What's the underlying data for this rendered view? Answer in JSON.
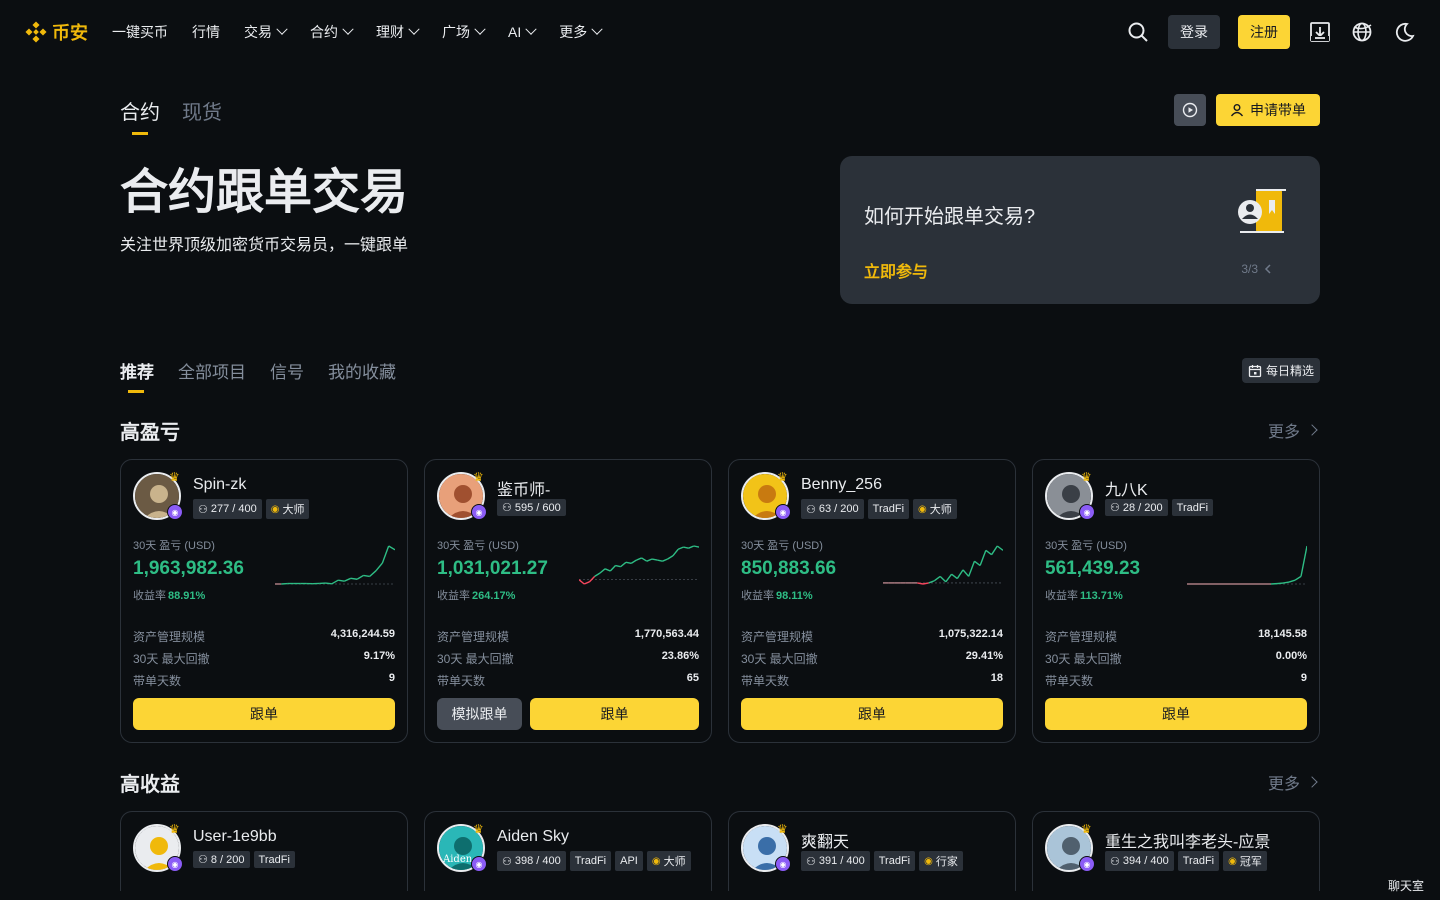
{
  "nav": {
    "logo_text": "币安",
    "items": [
      {
        "label": "一键买币",
        "dropdown": false
      },
      {
        "label": "行情",
        "dropdown": false
      },
      {
        "label": "交易",
        "dropdown": true
      },
      {
        "label": "合约",
        "dropdown": true
      },
      {
        "label": "理财",
        "dropdown": true
      },
      {
        "label": "广场",
        "dropdown": true
      },
      {
        "label": "AI",
        "dropdown": true
      },
      {
        "label": "更多",
        "dropdown": true
      }
    ],
    "login": "登录",
    "register": "注册"
  },
  "type_tabs": [
    "合约",
    "现货"
  ],
  "apply_button": "申请带单",
  "hero": {
    "title": "合约跟单交易",
    "subtitle": "关注世界顶级加密货币交易员，一键跟单"
  },
  "howto": {
    "title": "如何开始跟单交易?",
    "link": "立即参与",
    "page": "3/3"
  },
  "section_tabs": [
    "推荐",
    "全部项目",
    "信号",
    "我的收藏"
  ],
  "daily_pick": "每日精选",
  "sections": {
    "high_pnl": {
      "title": "高盈亏",
      "more": "更多"
    },
    "high_roi": {
      "title": "高收益",
      "more": "更多"
    }
  },
  "labels": {
    "pnl": "30天 盈亏 (USD)",
    "roi": "收益率",
    "aum": "资产管理规模",
    "mdd": "30天 最大回撤",
    "days": "带单天数",
    "follow": "跟单",
    "simulate": "模拟跟单"
  },
  "cards": [
    {
      "name": "Spin-zk",
      "followers": "277 / 400",
      "tags": [
        {
          "text": "大师",
          "icon": true
        }
      ],
      "pnl": "1,963,982.36",
      "roi": "88.91%",
      "aum": "4,316,244.59",
      "mdd": "9.17%",
      "days": "9",
      "simulate": false,
      "spark": [
        0,
        0,
        0.5,
        0.5,
        0.5,
        0.5,
        0.3,
        0.6,
        1,
        0.2,
        4,
        3,
        6,
        5,
        9,
        8,
        14,
        22,
        40,
        36
      ]
    },
    {
      "name": "鉴币师-",
      "followers": "595 / 600",
      "tags": [],
      "pnl": "1,031,021.27",
      "roi": "264.17%",
      "aum": "1,770,563.44",
      "mdd": "23.86%",
      "days": "65",
      "simulate": true,
      "spark": [
        2,
        -2,
        0,
        5,
        8,
        12,
        10,
        15,
        14,
        18,
        17,
        20,
        22,
        19,
        21,
        20,
        19,
        21,
        24,
        30,
        32,
        31,
        33,
        32
      ]
    },
    {
      "name": "Benny_256",
      "followers": "63 / 200",
      "tags": [
        {
          "text": "TradFi",
          "icon": false
        },
        {
          "text": "大师",
          "icon": true
        }
      ],
      "pnl": "850,883.66",
      "roi": "98.11%",
      "aum": "1,075,322.14",
      "mdd": "29.41%",
      "days": "18",
      "simulate": false,
      "spark": [
        0,
        0,
        0,
        0,
        0,
        0,
        0,
        -1,
        0,
        2,
        6,
        1,
        8,
        4,
        12,
        6,
        20,
        16,
        30,
        26,
        34,
        30
      ]
    },
    {
      "name": "九八K",
      "followers": "28 / 200",
      "tags": [
        {
          "text": "TradFi",
          "icon": false
        }
      ],
      "pnl": "561,439.23",
      "roi": "113.71%",
      "aum": "18,145.58",
      "mdd": "0.00%",
      "days": "9",
      "simulate": false,
      "spark": [
        0,
        0,
        0,
        0,
        0,
        0,
        0,
        0,
        0,
        0,
        0,
        0,
        0,
        0,
        0,
        0.4,
        1,
        2,
        4,
        8,
        40
      ]
    }
  ],
  "cards2": [
    {
      "name": "User-1e9bb",
      "followers": "8 / 200",
      "tags": [
        {
          "text": "TradFi",
          "icon": false
        }
      ]
    },
    {
      "name": "Aiden Sky",
      "followers": "398 / 400",
      "tags": [
        {
          "text": "TradFi",
          "icon": false
        },
        {
          "text": "API",
          "icon": false
        },
        {
          "text": "大师",
          "icon": true
        }
      ],
      "avatar_text": "Aiden"
    },
    {
      "name": "爽翻天",
      "followers": "391 / 400",
      "tags": [
        {
          "text": "TradFi",
          "icon": false
        },
        {
          "text": "行家",
          "icon": true
        }
      ]
    },
    {
      "name": "重生之我叫李老头-应景",
      "followers": "394 / 400",
      "tags": [
        {
          "text": "TradFi",
          "icon": false
        },
        {
          "text": "冠军",
          "icon": true
        }
      ]
    }
  ],
  "chatroom": "聊天室",
  "colors": {
    "accent": "#fcd535",
    "brand": "#f0b90b",
    "up": "#2ebd85",
    "down": "#f6465d",
    "bg": "#0b0e11"
  }
}
